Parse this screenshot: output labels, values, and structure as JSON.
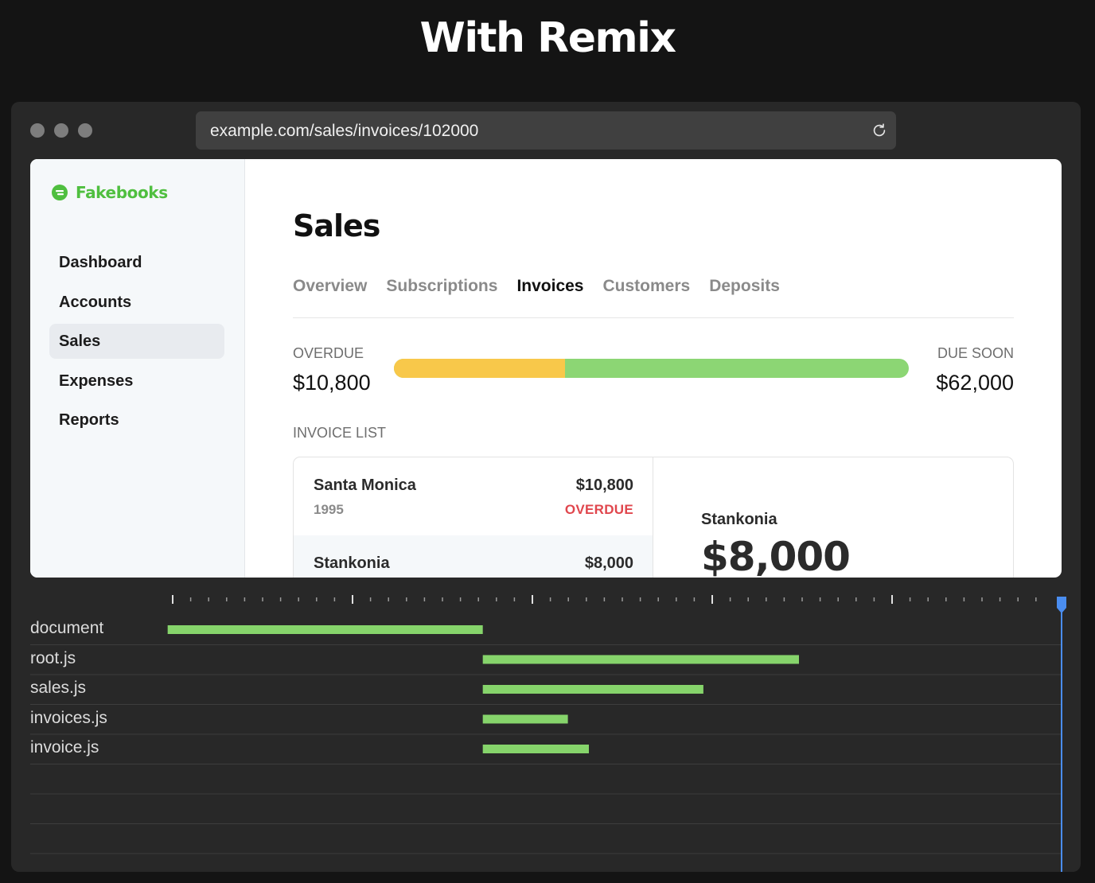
{
  "page": {
    "heading": "With Remix"
  },
  "browser": {
    "url": "example.com/sales/invoices/102000",
    "reload_icon": "reload-icon"
  },
  "app": {
    "brand": "Fakebooks",
    "brand_color": "#4fbf3f",
    "nav": [
      {
        "label": "Dashboard",
        "active": false
      },
      {
        "label": "Accounts",
        "active": false
      },
      {
        "label": "Sales",
        "active": true
      },
      {
        "label": "Expenses",
        "active": false
      },
      {
        "label": "Reports",
        "active": false
      }
    ],
    "title": "Sales",
    "tabs": [
      {
        "label": "Overview",
        "active": false
      },
      {
        "label": "Subscriptions",
        "active": false
      },
      {
        "label": "Invoices",
        "active": true
      },
      {
        "label": "Customers",
        "active": false
      },
      {
        "label": "Deposits",
        "active": false
      }
    ],
    "overdue": {
      "label": "OVERDUE",
      "amount": "$10,800"
    },
    "due_soon": {
      "label": "DUE SOON",
      "amount": "$62,000"
    },
    "progress_overdue_fraction": 0.333,
    "progress_colors": {
      "overdue": "#f8c84a",
      "due_soon": "#8cd674"
    },
    "invoice_list_label": "INVOICE LIST",
    "invoices": [
      {
        "name": "Santa Monica",
        "year": "1995",
        "amount": "$10,800",
        "status": "OVERDUE"
      },
      {
        "name": "Stankonia",
        "year": "",
        "amount": "$8,000",
        "status": ""
      }
    ],
    "detail": {
      "name": "Stankonia",
      "amount": "$8,000"
    }
  },
  "timeline": {
    "bar_color": "#86d46b",
    "cursor_color": "#4a8df0",
    "range": [
      0,
      100
    ],
    "rows": [
      {
        "label": "document",
        "start": 14.9,
        "end": 44.9
      },
      {
        "label": "root.js",
        "start": 44.9,
        "end": 75.0
      },
      {
        "label": "sales.js",
        "start": 44.9,
        "end": 65.9
      },
      {
        "label": "invoices.js",
        "start": 44.9,
        "end": 53.0
      },
      {
        "label": "invoice.js",
        "start": 44.9,
        "end": 55.0
      }
    ],
    "cursor": 100
  }
}
